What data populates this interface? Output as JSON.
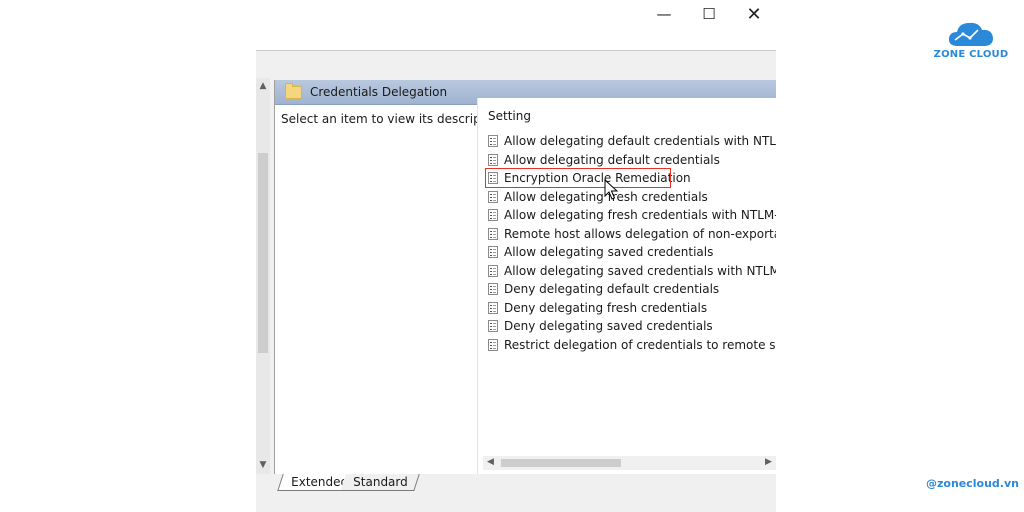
{
  "window": {
    "caption_icons": [
      "minimize-icon",
      "maximize-icon",
      "close-icon"
    ]
  },
  "pane": {
    "title": "Credentials Delegation",
    "description_prompt": "Select an item to view its description.",
    "column_header": "Setting",
    "settings": [
      "Allow delegating default credentials with NTLM-only",
      "Allow delegating default credentials",
      "Encryption Oracle Remediation",
      "Allow delegating fresh credentials",
      "Allow delegating fresh credentials with NTLM-only s",
      "Remote host allows delegation of non-exportable cre",
      "Allow delegating saved credentials",
      "Allow delegating saved credentials with NTLM-only s",
      "Deny delegating default credentials",
      "Deny delegating fresh credentials",
      "Deny delegating saved credentials",
      "Restrict delegation of credentials to remote servers"
    ],
    "highlighted_setting": "Encryption Oracle Remediation",
    "highlight_color": "#e5332a"
  },
  "tabs": [
    "Extended",
    "Standard"
  ],
  "active_tab": "Extended",
  "branding": {
    "logo_text": "ZONE CLOUD",
    "handle": "@zonecloud.vn",
    "color": "#2a89d8"
  }
}
